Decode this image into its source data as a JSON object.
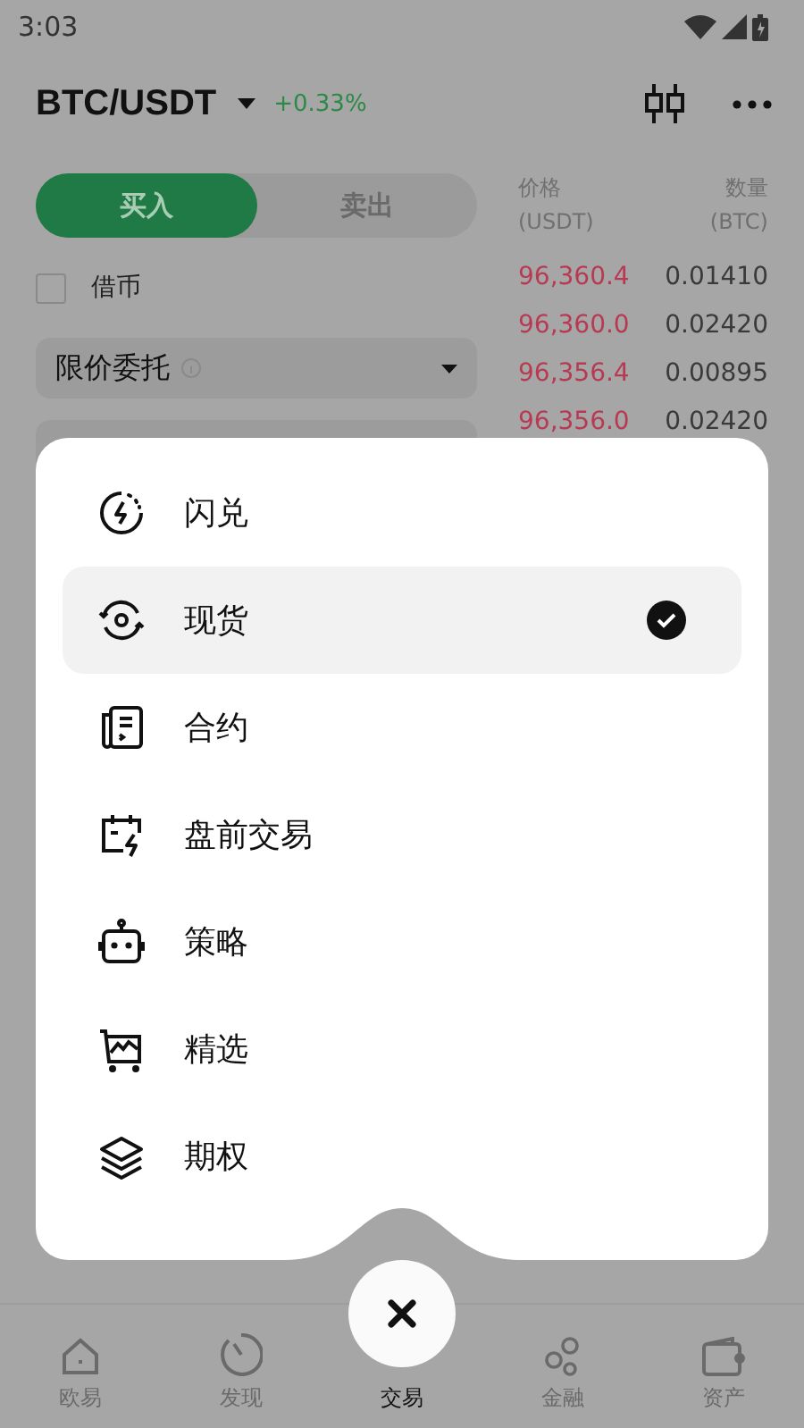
{
  "status_bar": {
    "time": "3:03"
  },
  "header": {
    "pair": "BTC/USDT",
    "change": "+0.33%"
  },
  "trade_tabs": [
    {
      "label": "买入",
      "selected": true
    },
    {
      "label": "卖出",
      "selected": false
    }
  ],
  "borrow": {
    "label": "借币",
    "checked": false
  },
  "order_type": {
    "label": "限价委托"
  },
  "order_book": {
    "columns": [
      {
        "label": "价格",
        "unit": "(USDT)"
      },
      {
        "label": "数量",
        "unit": "(BTC)"
      }
    ],
    "rows": [
      {
        "price": "96,360.4",
        "amount": "0.01410"
      },
      {
        "price": "96,360.0",
        "amount": "0.02420"
      },
      {
        "price": "96,356.4",
        "amount": "0.00895"
      },
      {
        "price": "96,356.0",
        "amount": "0.02420"
      }
    ]
  },
  "menu": {
    "items": [
      {
        "label": "闪兑",
        "selected": false
      },
      {
        "label": "现货",
        "selected": true
      },
      {
        "label": "合约",
        "selected": false
      },
      {
        "label": "盘前交易",
        "selected": false
      },
      {
        "label": "策略",
        "selected": false
      },
      {
        "label": "精选",
        "selected": false
      },
      {
        "label": "期权",
        "selected": false
      }
    ]
  },
  "nav": {
    "items": [
      {
        "label": "欧易",
        "selected": false
      },
      {
        "label": "发现",
        "selected": false
      },
      {
        "label": "交易",
        "selected": true
      },
      {
        "label": "金融",
        "selected": false
      },
      {
        "label": "资产",
        "selected": false
      }
    ]
  }
}
